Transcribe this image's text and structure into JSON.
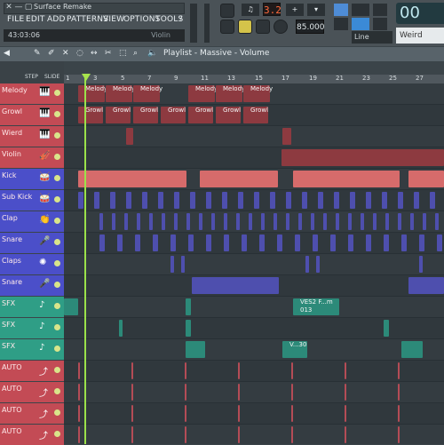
{
  "app": {
    "title": "Surface Remake",
    "hint": "43:03:06",
    "hint_right": "Violin",
    "menu": [
      "FILE",
      "EDIT",
      "ADD",
      "PATTERNS",
      "VIEW",
      "OPTIONS",
      "TOOLS",
      "?"
    ],
    "pattern_number": "3.2",
    "tempo": "85.000",
    "clock": "00",
    "snap": "Line",
    "browser": "Weird"
  },
  "playlist": {
    "title": "Playlist - Massive - Volume",
    "tools": [
      "STEP",
      "SLIDE"
    ],
    "bars": [
      "1",
      "3",
      "5",
      "7",
      "9",
      "11",
      "13",
      "15",
      "17",
      "19",
      "21",
      "23",
      "25",
      "27"
    ],
    "tracks": [
      {
        "name": "Melody",
        "color": "#c34b55",
        "icon": "piano-icon"
      },
      {
        "name": "Growl",
        "color": "#c34b55",
        "icon": "piano-icon"
      },
      {
        "name": "Wierd",
        "color": "#c34b55",
        "icon": "piano-icon"
      },
      {
        "name": "Violin",
        "color": "#c34b55",
        "icon": "violin-icon"
      },
      {
        "name": "Kick",
        "color": "#4b4fc9",
        "icon": "drum-icon"
      },
      {
        "name": "Sub Kick",
        "color": "#4b4fc9",
        "icon": "drum-icon"
      },
      {
        "name": "Clap",
        "color": "#4b4fc9",
        "icon": "clap-icon"
      },
      {
        "name": "Snare",
        "color": "#4b4fc9",
        "icon": "mic-icon"
      },
      {
        "name": "Claps",
        "color": "#4b4fc9",
        "icon": "splash-icon"
      },
      {
        "name": "Snare",
        "color": "#4b4fc9",
        "icon": "mic-icon"
      },
      {
        "name": "SFX",
        "color": "#2f9e86",
        "icon": "note-icon"
      },
      {
        "name": "SFX",
        "color": "#2f9e86",
        "icon": "note-icon"
      },
      {
        "name": "SFX",
        "color": "#2f9e86",
        "icon": "note-icon"
      },
      {
        "name": "AUTO",
        "color": "#c34b55",
        "icon": "automation-icon"
      },
      {
        "name": "AUTO",
        "color": "#c34b55",
        "icon": "automation-icon"
      },
      {
        "name": "AUTO",
        "color": "#c34b55",
        "icon": "automation-icon"
      },
      {
        "name": "AUTO",
        "color": "#c34b55",
        "icon": "automation-icon"
      }
    ],
    "clip_labels": {
      "melody": "Melody",
      "growl": "Growl",
      "sfx1": "VES2 F...m 013",
      "sfx2": "V...30"
    }
  }
}
